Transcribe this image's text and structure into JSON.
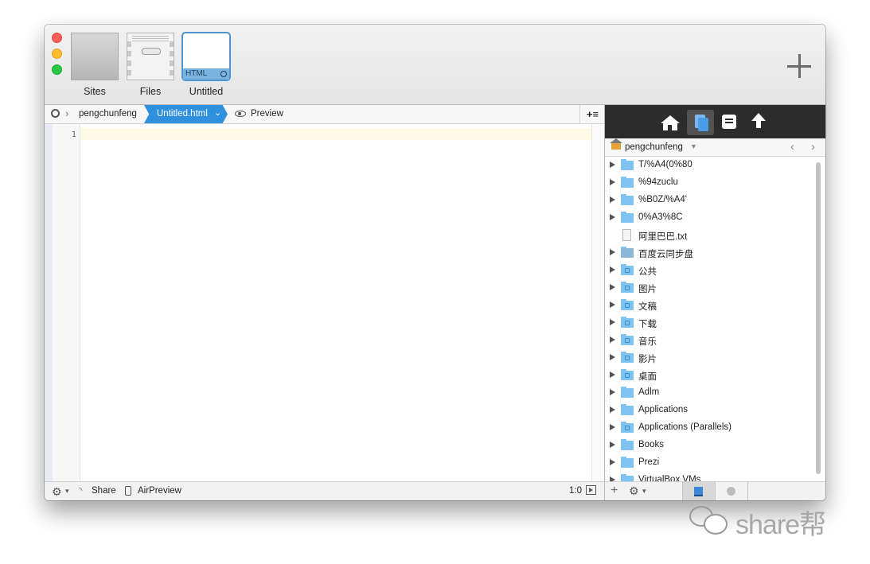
{
  "toolbar": {
    "tabs": [
      {
        "label": "Sites"
      },
      {
        "label": "Files"
      },
      {
        "label": "Untitled",
        "badge": "HTML"
      }
    ]
  },
  "breadcrumb": {
    "user": "pengchunfeng",
    "file": "Untitled.html",
    "preview": "Preview",
    "menu": "+≡"
  },
  "editor": {
    "line_number": "1"
  },
  "status_left": {
    "share": "Share",
    "airpreview": "AirPreview",
    "position": "1:0"
  },
  "right_panel": {
    "path_user": "pengchunfeng",
    "items": [
      {
        "name": "T/%A4(0%80",
        "type": "folder"
      },
      {
        "name": "%94zuclu",
        "type": "folder"
      },
      {
        "name": "%B0Z/%A4'",
        "type": "folder"
      },
      {
        "name": "0%A3%8C",
        "type": "folder"
      },
      {
        "name": "阿里巴巴.txt",
        "type": "file"
      },
      {
        "name": "百度云同步盘",
        "type": "folder-cloud"
      },
      {
        "name": "公共",
        "type": "folder-sys"
      },
      {
        "name": "图片",
        "type": "folder-sys"
      },
      {
        "name": "文稿",
        "type": "folder-sys"
      },
      {
        "name": "下载",
        "type": "folder-sys"
      },
      {
        "name": "音乐",
        "type": "folder-sys"
      },
      {
        "name": "影片",
        "type": "folder-sys"
      },
      {
        "name": "桌面",
        "type": "folder-sys"
      },
      {
        "name": "Adlm",
        "type": "folder"
      },
      {
        "name": "Applications",
        "type": "folder"
      },
      {
        "name": "Applications (Parallels)",
        "type": "folder-sys"
      },
      {
        "name": "Books",
        "type": "folder"
      },
      {
        "name": "Prezi",
        "type": "folder"
      },
      {
        "name": "VirtualBox VMs",
        "type": "folder"
      }
    ]
  },
  "watermark": {
    "text": "share帮"
  },
  "colors": {
    "accent": "#2f91de",
    "folder": "#7ec3f2",
    "nav_dark": "#2c2c2c"
  }
}
